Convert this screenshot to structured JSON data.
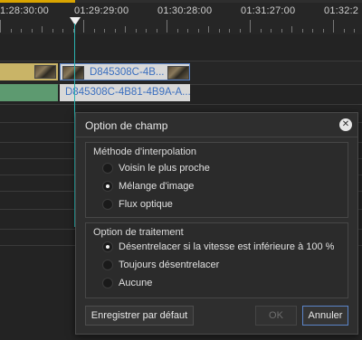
{
  "ruler": {
    "timecodes": [
      "1:28:30:00",
      "01:29:29:00",
      "01:30:28:00",
      "01:31:27:00",
      "01:32:2"
    ]
  },
  "clips": {
    "video_clip_label": "D845308C-4B...",
    "audio_clip_label": "D845308C-4B81-4B9A-A..."
  },
  "dialog": {
    "title": "Option de champ",
    "interpolation": {
      "title": "Méthode d'interpolation",
      "options": [
        "Voisin le plus proche",
        "Mélange d'image",
        "Flux optique"
      ],
      "selected_index": 1
    },
    "processing": {
      "title": "Option de traitement",
      "options": [
        "Désentrelacer si la vitesse est inférieure à 100 %",
        "Toujours désentrelacer",
        "Aucune"
      ],
      "selected_index": 0
    },
    "buttons": {
      "save_default": "Enregistrer par défaut",
      "ok": "OK",
      "cancel": "Annuler"
    }
  },
  "colors": {
    "playhead": "#2bb3b0",
    "video_clip": "#c9b467",
    "audio_clip": "#5d9a70",
    "selected_clip": "#d8d8d8",
    "clip_text": "#3b6fbf"
  }
}
